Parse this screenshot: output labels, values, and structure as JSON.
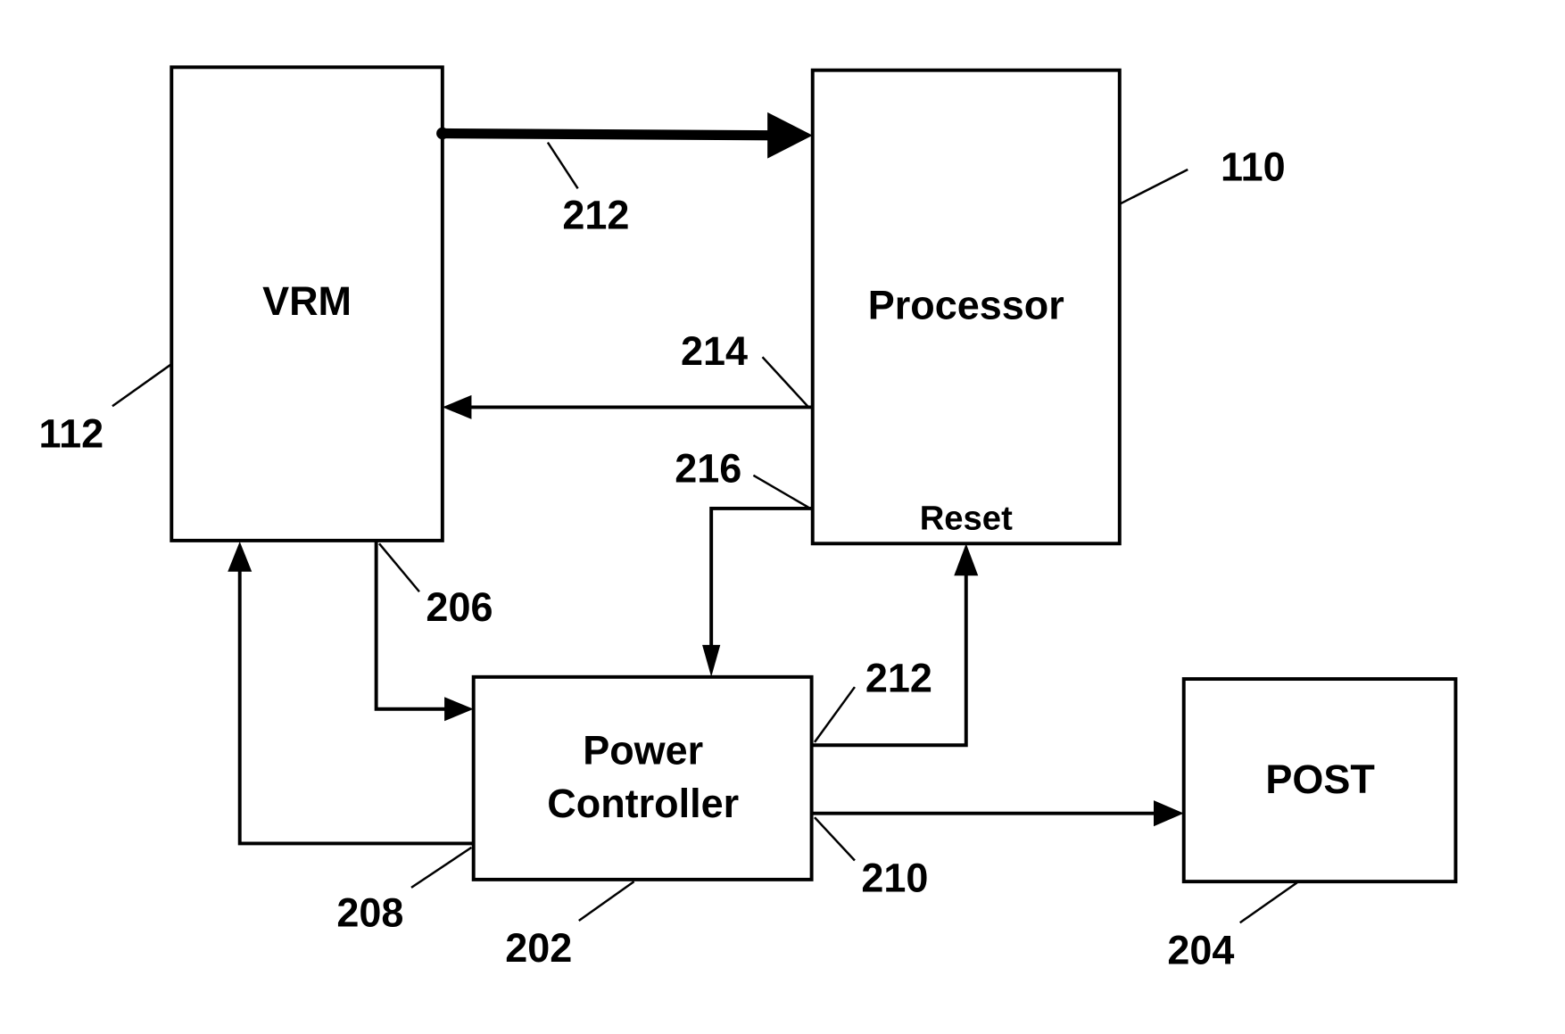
{
  "diagram": {
    "type": "block-diagram",
    "blocks": {
      "vrm": {
        "label": "VRM",
        "ref": "112"
      },
      "processor": {
        "label": "Processor",
        "ref": "110",
        "pin_label": "Reset"
      },
      "power_controller": {
        "label_line1": "Power",
        "label_line2": "Controller",
        "ref": "202"
      },
      "post": {
        "label": "POST",
        "ref": "204"
      }
    },
    "connections": [
      {
        "id": "vrm-to-processor-bus",
        "from": "VRM",
        "to": "Processor",
        "ref": "212",
        "style": "thick"
      },
      {
        "id": "processor-to-vrm",
        "from": "Processor",
        "to": "VRM",
        "ref": "214"
      },
      {
        "id": "processor-to-power-controller",
        "from": "Processor",
        "to": "Power Controller",
        "ref": "216"
      },
      {
        "id": "vrm-to-power-controller",
        "from": "VRM",
        "to": "Power Controller",
        "ref": "206"
      },
      {
        "id": "power-controller-to-vrm",
        "from": "Power Controller",
        "to": "VRM",
        "ref": "208"
      },
      {
        "id": "power-controller-to-reset",
        "from": "Power Controller",
        "to": "Processor Reset",
        "ref": "212"
      },
      {
        "id": "power-controller-to-post",
        "from": "Power Controller",
        "to": "POST",
        "ref": "210"
      }
    ],
    "refs": {
      "bus_top": "212",
      "r214": "214",
      "r216": "216",
      "r206": "206",
      "r208": "208",
      "r212_reset": "212",
      "r210": "210"
    }
  }
}
